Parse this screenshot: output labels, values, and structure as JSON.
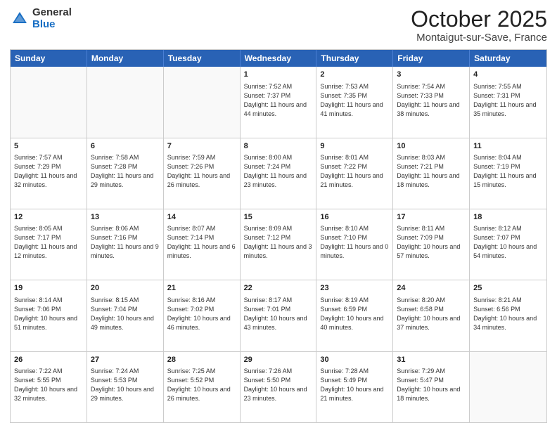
{
  "header": {
    "logo_general": "General",
    "logo_blue": "Blue",
    "month_title": "October 2025",
    "location": "Montaigut-sur-Save, France"
  },
  "days_of_week": [
    "Sunday",
    "Monday",
    "Tuesday",
    "Wednesday",
    "Thursday",
    "Friday",
    "Saturday"
  ],
  "weeks": [
    [
      {
        "day": "",
        "content": ""
      },
      {
        "day": "",
        "content": ""
      },
      {
        "day": "",
        "content": ""
      },
      {
        "day": "1",
        "content": "Sunrise: 7:52 AM\nSunset: 7:37 PM\nDaylight: 11 hours\nand 44 minutes."
      },
      {
        "day": "2",
        "content": "Sunrise: 7:53 AM\nSunset: 7:35 PM\nDaylight: 11 hours\nand 41 minutes."
      },
      {
        "day": "3",
        "content": "Sunrise: 7:54 AM\nSunset: 7:33 PM\nDaylight: 11 hours\nand 38 minutes."
      },
      {
        "day": "4",
        "content": "Sunrise: 7:55 AM\nSunset: 7:31 PM\nDaylight: 11 hours\nand 35 minutes."
      }
    ],
    [
      {
        "day": "5",
        "content": "Sunrise: 7:57 AM\nSunset: 7:29 PM\nDaylight: 11 hours\nand 32 minutes."
      },
      {
        "day": "6",
        "content": "Sunrise: 7:58 AM\nSunset: 7:28 PM\nDaylight: 11 hours\nand 29 minutes."
      },
      {
        "day": "7",
        "content": "Sunrise: 7:59 AM\nSunset: 7:26 PM\nDaylight: 11 hours\nand 26 minutes."
      },
      {
        "day": "8",
        "content": "Sunrise: 8:00 AM\nSunset: 7:24 PM\nDaylight: 11 hours\nand 23 minutes."
      },
      {
        "day": "9",
        "content": "Sunrise: 8:01 AM\nSunset: 7:22 PM\nDaylight: 11 hours\nand 21 minutes."
      },
      {
        "day": "10",
        "content": "Sunrise: 8:03 AM\nSunset: 7:21 PM\nDaylight: 11 hours\nand 18 minutes."
      },
      {
        "day": "11",
        "content": "Sunrise: 8:04 AM\nSunset: 7:19 PM\nDaylight: 11 hours\nand 15 minutes."
      }
    ],
    [
      {
        "day": "12",
        "content": "Sunrise: 8:05 AM\nSunset: 7:17 PM\nDaylight: 11 hours\nand 12 minutes."
      },
      {
        "day": "13",
        "content": "Sunrise: 8:06 AM\nSunset: 7:16 PM\nDaylight: 11 hours\nand 9 minutes."
      },
      {
        "day": "14",
        "content": "Sunrise: 8:07 AM\nSunset: 7:14 PM\nDaylight: 11 hours\nand 6 minutes."
      },
      {
        "day": "15",
        "content": "Sunrise: 8:09 AM\nSunset: 7:12 PM\nDaylight: 11 hours\nand 3 minutes."
      },
      {
        "day": "16",
        "content": "Sunrise: 8:10 AM\nSunset: 7:10 PM\nDaylight: 11 hours\nand 0 minutes."
      },
      {
        "day": "17",
        "content": "Sunrise: 8:11 AM\nSunset: 7:09 PM\nDaylight: 10 hours\nand 57 minutes."
      },
      {
        "day": "18",
        "content": "Sunrise: 8:12 AM\nSunset: 7:07 PM\nDaylight: 10 hours\nand 54 minutes."
      }
    ],
    [
      {
        "day": "19",
        "content": "Sunrise: 8:14 AM\nSunset: 7:06 PM\nDaylight: 10 hours\nand 51 minutes."
      },
      {
        "day": "20",
        "content": "Sunrise: 8:15 AM\nSunset: 7:04 PM\nDaylight: 10 hours\nand 49 minutes."
      },
      {
        "day": "21",
        "content": "Sunrise: 8:16 AM\nSunset: 7:02 PM\nDaylight: 10 hours\nand 46 minutes."
      },
      {
        "day": "22",
        "content": "Sunrise: 8:17 AM\nSunset: 7:01 PM\nDaylight: 10 hours\nand 43 minutes."
      },
      {
        "day": "23",
        "content": "Sunrise: 8:19 AM\nSunset: 6:59 PM\nDaylight: 10 hours\nand 40 minutes."
      },
      {
        "day": "24",
        "content": "Sunrise: 8:20 AM\nSunset: 6:58 PM\nDaylight: 10 hours\nand 37 minutes."
      },
      {
        "day": "25",
        "content": "Sunrise: 8:21 AM\nSunset: 6:56 PM\nDaylight: 10 hours\nand 34 minutes."
      }
    ],
    [
      {
        "day": "26",
        "content": "Sunrise: 7:22 AM\nSunset: 5:55 PM\nDaylight: 10 hours\nand 32 minutes."
      },
      {
        "day": "27",
        "content": "Sunrise: 7:24 AM\nSunset: 5:53 PM\nDaylight: 10 hours\nand 29 minutes."
      },
      {
        "day": "28",
        "content": "Sunrise: 7:25 AM\nSunset: 5:52 PM\nDaylight: 10 hours\nand 26 minutes."
      },
      {
        "day": "29",
        "content": "Sunrise: 7:26 AM\nSunset: 5:50 PM\nDaylight: 10 hours\nand 23 minutes."
      },
      {
        "day": "30",
        "content": "Sunrise: 7:28 AM\nSunset: 5:49 PM\nDaylight: 10 hours\nand 21 minutes."
      },
      {
        "day": "31",
        "content": "Sunrise: 7:29 AM\nSunset: 5:47 PM\nDaylight: 10 hours\nand 18 minutes."
      },
      {
        "day": "",
        "content": ""
      }
    ]
  ]
}
